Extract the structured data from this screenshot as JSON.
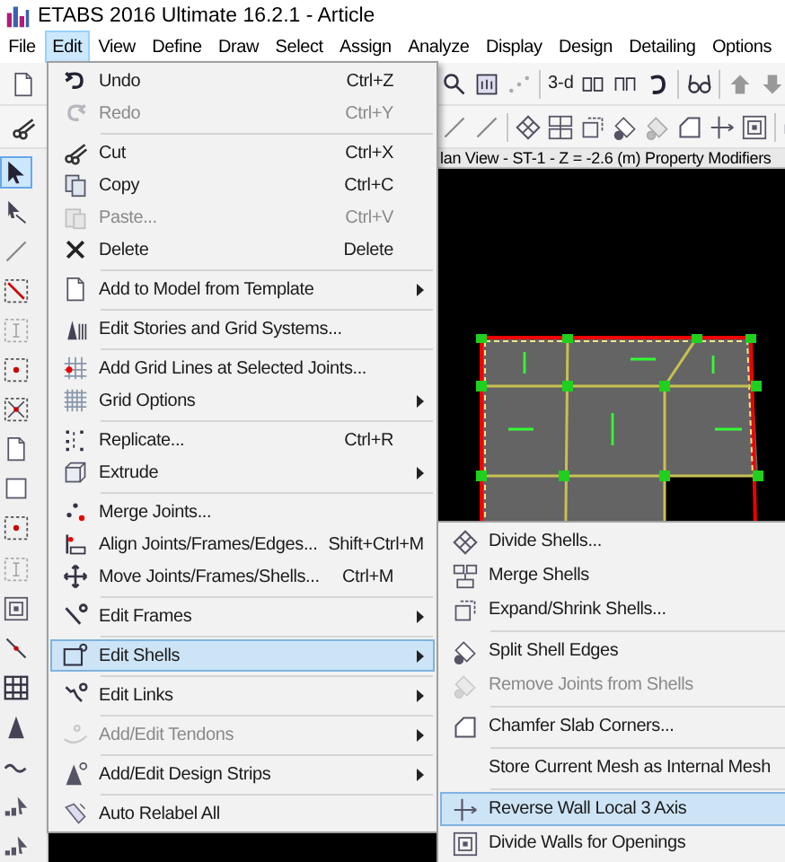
{
  "window": {
    "title": "ETABS 2016 Ultimate 16.2.1 - Article"
  },
  "menu_bar": [
    {
      "label": "File",
      "selected": false
    },
    {
      "label": "Edit",
      "selected": true
    },
    {
      "label": "View",
      "selected": false
    },
    {
      "label": "Define",
      "selected": false
    },
    {
      "label": "Draw",
      "selected": false
    },
    {
      "label": "Select",
      "selected": false
    },
    {
      "label": "Assign",
      "selected": false
    },
    {
      "label": "Analyze",
      "selected": false
    },
    {
      "label": "Display",
      "selected": false
    },
    {
      "label": "Design",
      "selected": false
    },
    {
      "label": "Detailing",
      "selected": false
    },
    {
      "label": "Options",
      "selected": false
    }
  ],
  "toolbar": {
    "view_button": "3-d"
  },
  "view": {
    "title": "lan View - ST-1 - Z = -2.6 (m)  Property Modifiers"
  },
  "edit_menu": {
    "groups": [
      {
        "items": [
          {
            "label": "Undo",
            "shortcut": "Ctrl+Z",
            "disabled": false,
            "submenu": false,
            "selected": false
          },
          {
            "label": "Redo",
            "shortcut": "Ctrl+Y",
            "disabled": true,
            "submenu": false,
            "selected": false
          }
        ]
      },
      {
        "items": [
          {
            "label": "Cut",
            "shortcut": "Ctrl+X",
            "disabled": false,
            "submenu": false,
            "selected": false
          },
          {
            "label": "Copy",
            "shortcut": "Ctrl+C",
            "disabled": false,
            "submenu": false,
            "selected": false
          },
          {
            "label": "Paste...",
            "shortcut": "Ctrl+V",
            "disabled": true,
            "submenu": false,
            "selected": false
          },
          {
            "label": "Delete",
            "shortcut": "Delete",
            "disabled": false,
            "submenu": false,
            "selected": false
          }
        ]
      },
      {
        "items": [
          {
            "label": "Add to Model from Template",
            "disabled": false,
            "submenu": true,
            "selected": false
          }
        ]
      },
      {
        "items": [
          {
            "label": "Edit Stories and Grid Systems...",
            "disabled": false,
            "submenu": false,
            "selected": false
          }
        ]
      },
      {
        "items": [
          {
            "label": "Add Grid Lines at Selected Joints...",
            "disabled": false,
            "submenu": false,
            "selected": false
          },
          {
            "label": "Grid Options",
            "disabled": false,
            "submenu": true,
            "selected": false
          }
        ]
      },
      {
        "items": [
          {
            "label": "Replicate...",
            "shortcut": "Ctrl+R",
            "disabled": false,
            "submenu": false,
            "selected": false
          },
          {
            "label": "Extrude",
            "disabled": false,
            "submenu": true,
            "selected": false
          }
        ]
      },
      {
        "items": [
          {
            "label": "Merge Joints...",
            "disabled": false,
            "submenu": false,
            "selected": false
          },
          {
            "label": "Align Joints/Frames/Edges...",
            "shortcut": "Shift+Ctrl+M",
            "disabled": false,
            "submenu": false,
            "selected": false
          },
          {
            "label": "Move Joints/Frames/Shells...",
            "shortcut": "Ctrl+M",
            "disabled": false,
            "submenu": false,
            "selected": false
          }
        ]
      },
      {
        "items": [
          {
            "label": "Edit Frames",
            "disabled": false,
            "submenu": true,
            "selected": false
          }
        ]
      },
      {
        "items": [
          {
            "label": "Edit Shells",
            "disabled": false,
            "submenu": true,
            "selected": true
          }
        ]
      },
      {
        "items": [
          {
            "label": "Edit Links",
            "disabled": false,
            "submenu": true,
            "selected": false
          }
        ]
      },
      {
        "items": [
          {
            "label": "Add/Edit Tendons",
            "disabled": true,
            "submenu": true,
            "selected": false
          }
        ]
      },
      {
        "items": [
          {
            "label": "Add/Edit Design Strips",
            "disabled": false,
            "submenu": true,
            "selected": false
          }
        ]
      },
      {
        "items": [
          {
            "label": "Auto Relabel All",
            "disabled": false,
            "submenu": false,
            "selected": false
          }
        ]
      }
    ]
  },
  "shells_submenu": {
    "groups": [
      {
        "items": [
          {
            "label": "Divide Shells...",
            "disabled": false,
            "selected": false
          },
          {
            "label": "Merge Shells",
            "disabled": false,
            "selected": false
          },
          {
            "label": "Expand/Shrink Shells...",
            "disabled": false,
            "selected": false
          }
        ]
      },
      {
        "items": [
          {
            "label": "Split Shell Edges",
            "disabled": false,
            "selected": false
          },
          {
            "label": "Remove Joints from Shells",
            "disabled": true,
            "selected": false
          }
        ]
      },
      {
        "items": [
          {
            "label": "Chamfer Slab Corners...",
            "disabled": false,
            "selected": false
          }
        ]
      },
      {
        "items": [
          {
            "label": "Store Current Mesh as Internal Mesh",
            "disabled": false,
            "selected": false
          }
        ]
      },
      {
        "items": [
          {
            "label": "Reverse Wall Local 3 Axis",
            "disabled": false,
            "selected": true
          },
          {
            "label": "Divide Walls for Openings",
            "disabled": false,
            "selected": false
          }
        ]
      }
    ]
  }
}
